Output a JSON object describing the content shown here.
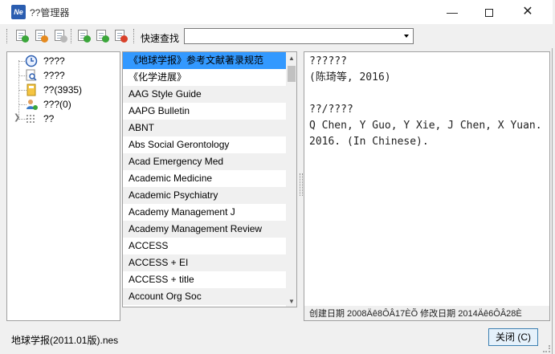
{
  "window": {
    "title": "??管理器",
    "app_icon_text": "Ne"
  },
  "toolbar": {
    "quick_find_label": "快速查找",
    "quick_find_value": ""
  },
  "tree": {
    "items": [
      {
        "label": "????"
      },
      {
        "label": "????"
      },
      {
        "label": "??(3935)"
      },
      {
        "label": "???(0)"
      },
      {
        "label": "??"
      }
    ]
  },
  "styles_list": {
    "items": [
      "《地球学报》参考文献著录规范",
      "《化学进展》",
      "AAG Style Guide",
      "AAPG Bulletin",
      "ABNT",
      "Abs Social Gerontology",
      "Acad Emergency Med",
      "Academic Medicine",
      "Academic Psychiatry",
      "Academy Management J",
      "Academy Management Review",
      "ACCESS",
      "ACCESS + EI",
      "ACCESS + title",
      "Account Org Soc"
    ],
    "selected_index": 0
  },
  "detail": {
    "text": "??????\n(陈琦等, 2016)\n\n??/????\nQ Chen, Y Guo, Y Xie, J Chen, X Yuan. 2016. (In Chinese).",
    "footer": "创建日期  2008Äê8ÔÂ17ÈÕ  修改日期  2014Äê6ÔÂ28È"
  },
  "status": {
    "file_name": "地球学报(2011.01版).nes",
    "close_button_label": "关闭 (C)"
  }
}
